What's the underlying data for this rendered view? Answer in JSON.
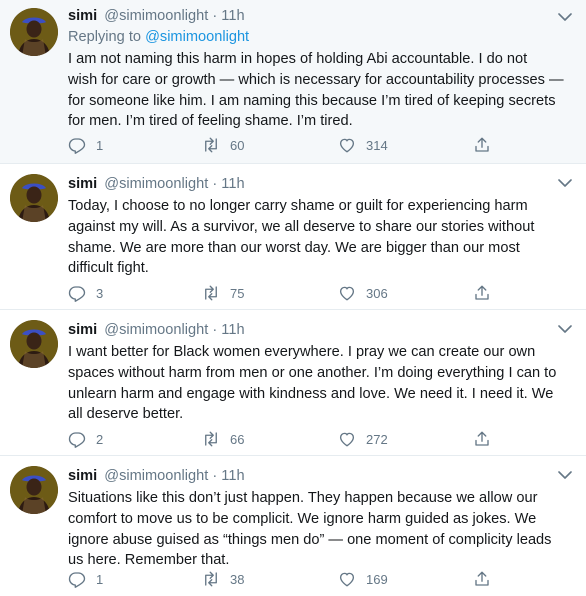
{
  "tweets": [
    {
      "name": "simi",
      "handle": "@simimoonlight",
      "separator": "·",
      "time": "11h",
      "replying_prefix": "Replying to",
      "replying_to": "@simimoonlight",
      "text": "I am not naming this harm in hopes of holding Abi accountable. I do not\nwish for care or growth — which is necessary for accountability processes —\nfor someone like him. I am naming this because I’m tired of keeping secrets\nfor men. I’m tired of feeling shame. I’m tired.",
      "replies": "1",
      "retweets": "60",
      "likes": "314"
    },
    {
      "name": "simi",
      "handle": "@simimoonlight",
      "separator": "·",
      "time": "11h",
      "text": "Today, I choose to no longer carry shame or guilt for experiencing harm\nagainst my will. As a survivor, we all deserve to share our stories without\nshame. We are more than our worst day. We are bigger than our most\ndifficult fight.",
      "replies": "3",
      "retweets": "75",
      "likes": "306"
    },
    {
      "name": "simi",
      "handle": "@simimoonlight",
      "separator": "·",
      "time": "11h",
      "text": "I want better for Black women everywhere. I pray we can create our own\nspaces without harm from men or one another. I’m doing everything I can to\nunlearn harm and engage with kindness and love. We need it. I need it. We\nall deserve better.",
      "replies": "2",
      "retweets": "66",
      "likes": "272"
    },
    {
      "name": "simi",
      "handle": "@simimoonlight",
      "separator": "·",
      "time": "11h",
      "text": "Situations like this don’t just happen. They happen because we allow our\ncomfort to move us to be complicit. We ignore harm guided as jokes. We\nignore abuse guised as “things men do” — one moment of complicity leads\nus here. Remember that.",
      "replies": "1",
      "retweets": "38",
      "likes": "169"
    }
  ],
  "icons": {
    "reply": "reply-icon",
    "retweet": "retweet-icon",
    "like": "heart-icon",
    "share": "share-icon",
    "caret": "chevron-down-icon"
  },
  "colors": {
    "secondary_text": "#657786",
    "link": "#1b95e0",
    "highlight_bg": "#f5f8fa"
  }
}
